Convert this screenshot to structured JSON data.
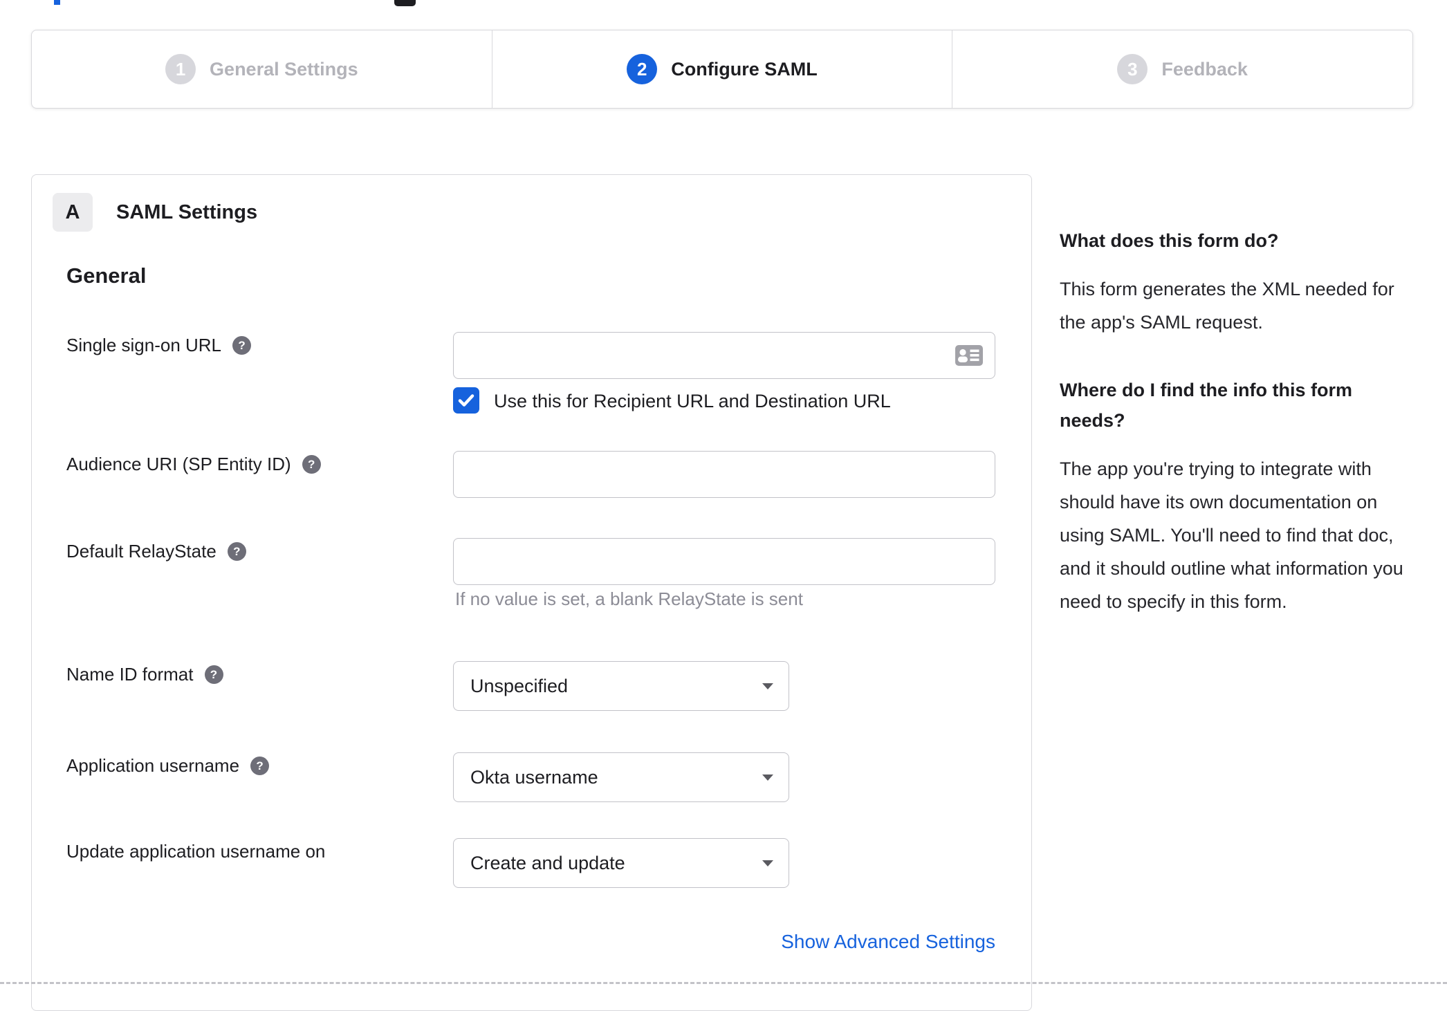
{
  "colors": {
    "accent_blue": "#1662dd",
    "text_dark": "#1d1d21",
    "inactive_gray": "#b3b3b9",
    "border_gray": "#d8d8dc",
    "helper_gray": "#8c8c96"
  },
  "stepper": {
    "steps": [
      {
        "number": "1",
        "label": "General Settings",
        "state": "inactive"
      },
      {
        "number": "2",
        "label": "Configure SAML",
        "state": "active"
      },
      {
        "number": "3",
        "label": "Feedback",
        "state": "inactive"
      }
    ]
  },
  "form": {
    "section_badge": "A",
    "section_title": "SAML Settings",
    "general_heading": "General",
    "sso": {
      "label": "Single sign-on URL",
      "value": "",
      "checkbox_label": "Use this for Recipient URL and Destination URL",
      "checkbox_checked": true
    },
    "audience": {
      "label": "Audience URI (SP Entity ID)",
      "value": ""
    },
    "relay_state": {
      "label": "Default RelayState",
      "value": "",
      "helper": "If no value is set, a blank RelayState is sent"
    },
    "name_id_format": {
      "label": "Name ID format",
      "selected": "Unspecified"
    },
    "application_username": {
      "label": "Application username",
      "selected": "Okta username"
    },
    "update_application_username": {
      "label": "Update application username on",
      "selected": "Create and update"
    },
    "advanced_link": "Show Advanced Settings"
  },
  "sidebar": {
    "heading1": "What does this form do?",
    "paragraph1": "This form generates the XML needed for the app's SAML request.",
    "heading2": "Where do I find the info this form needs?",
    "paragraph2": "The app you're trying to integrate with should have its own documentation on using SAML. You'll need to find that doc, and it should outline what information you need to specify in this form."
  },
  "icons": {
    "help_glyph": "?"
  }
}
